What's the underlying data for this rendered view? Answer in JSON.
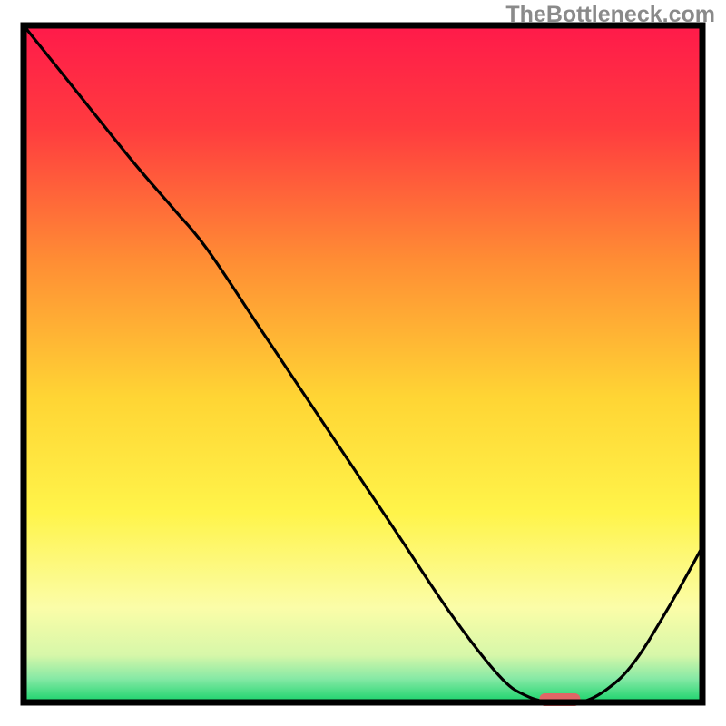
{
  "watermark": "TheBottleneck.com",
  "chart_data": {
    "type": "line",
    "title": "",
    "xlabel": "",
    "ylabel": "",
    "xlim": [
      0,
      100
    ],
    "ylim": [
      0,
      100
    ],
    "grid": false,
    "legend": false,
    "background_gradient": {
      "stops": [
        {
          "offset": 0.0,
          "color": "#ff1a4a"
        },
        {
          "offset": 0.15,
          "color": "#ff3b3f"
        },
        {
          "offset": 0.35,
          "color": "#ff8e34"
        },
        {
          "offset": 0.55,
          "color": "#ffd534"
        },
        {
          "offset": 0.72,
          "color": "#fff44a"
        },
        {
          "offset": 0.86,
          "color": "#fbfda8"
        },
        {
          "offset": 0.93,
          "color": "#d7f7a9"
        },
        {
          "offset": 0.965,
          "color": "#86e9a5"
        },
        {
          "offset": 1.0,
          "color": "#18d36b"
        }
      ]
    },
    "curve": {
      "name": "bottleneck",
      "x": [
        0,
        8,
        16,
        22,
        27,
        35,
        45,
        55,
        63,
        70,
        74,
        78,
        82,
        86,
        90,
        95,
        100
      ],
      "values": [
        100,
        90,
        80,
        73,
        67,
        55,
        40,
        25,
        13,
        4,
        1,
        0,
        0,
        2,
        6,
        14,
        23
      ]
    },
    "marker": {
      "name": "target",
      "x_start": 76,
      "x_end": 82,
      "y": 0,
      "color": "#e06666"
    }
  }
}
